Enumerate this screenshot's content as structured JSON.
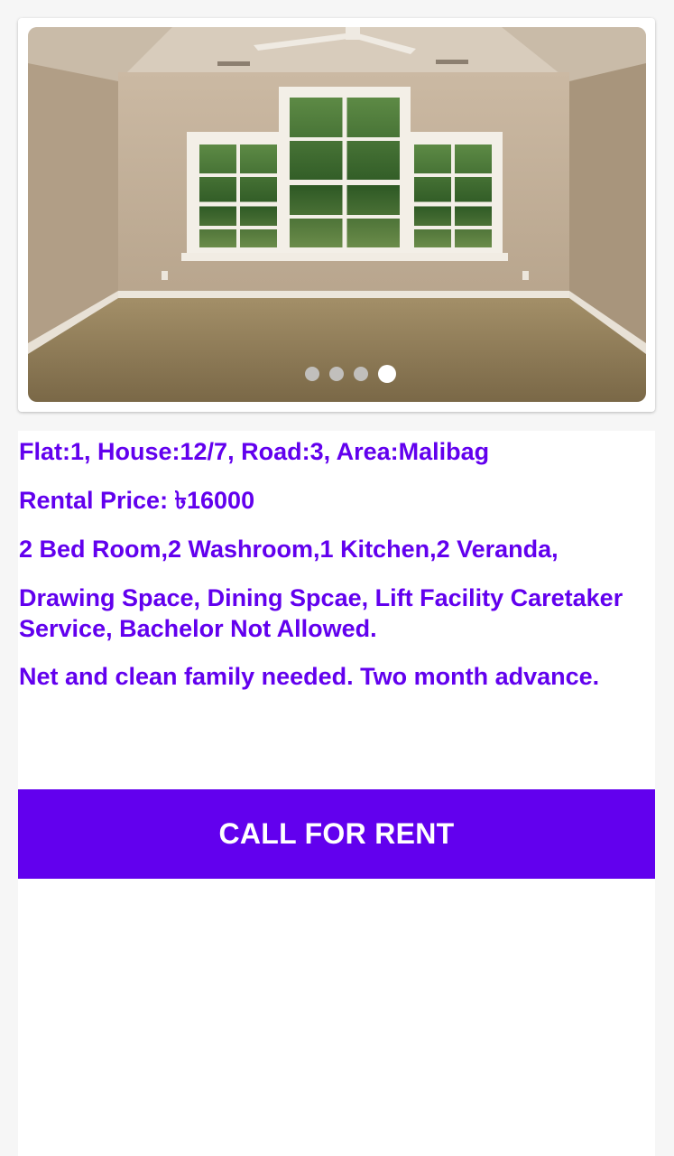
{
  "slider": {
    "image_alt": "Empty room with three windows",
    "dots": [
      {
        "active": false
      },
      {
        "active": false
      },
      {
        "active": false
      },
      {
        "active": true
      }
    ]
  },
  "listing": {
    "address": "Flat:1, House:12/7, Road:3, Area:Malibag",
    "rent": "Rental Price: ৳16000",
    "rooms": "2 Bed Room,2 Washroom,1 Kitchen,2 Veranda,",
    "facilities": "Drawing Space, Dining Spcae, Lift Facility Caretaker Service, Bachelor Not Allowed.",
    "note": "Net and clean family needed. Two month advance."
  },
  "actions": {
    "call_label": "CALL FOR RENT"
  },
  "colors": {
    "accent": "#6200ee",
    "card": "#ffffff",
    "background": "#f6f6f6"
  }
}
